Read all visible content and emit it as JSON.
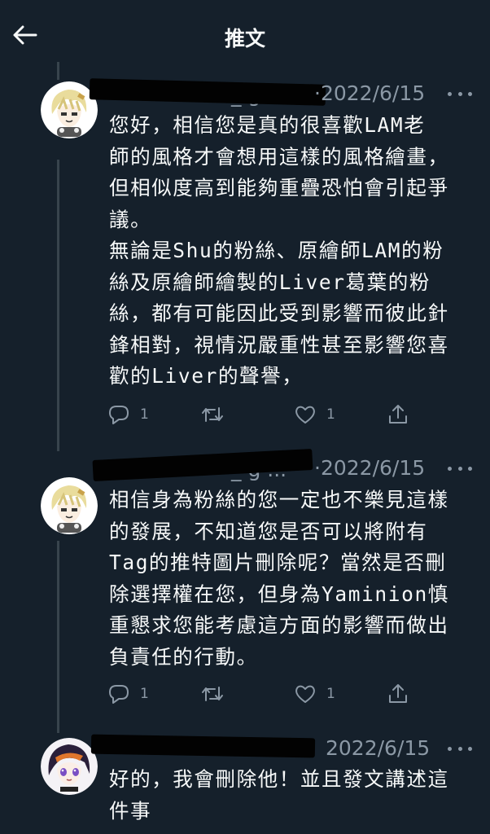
{
  "header": {
    "title": "推文"
  },
  "tweets": [
    {
      "name_visible": "_ g",
      "date": "·2022/6/15",
      "text": "您好，相信您是真的很喜歡LAM老\n師的風格才會想用這樣的風格繪畫，\n但相似度高到能夠重疊恐怕會引起爭\n議。\n無論是Shu的粉絲、原繪師LAM的粉\n絲及原繪師繪製的Liver葛葉的粉\n絲，都有可能因此受到影響而彼此針\n鋒相對，視情況嚴重性甚至影響您喜\n歡的Liver的聲譽，",
      "reply_count": "1",
      "like_count": "1"
    },
    {
      "name_visible": "_ g ...",
      "date": "·2022/6/15",
      "text": "相信身為粉絲的您一定也不樂見這樣\n的發展，不知道您是否可以將附有\nTag的推特圖片刪除呢？當然是否刪\n除選擇權在您，但身為Yaminion慎\n重懇求您能考慮這方面的影響而做出\n負責任的行動。",
      "reply_count": "1",
      "like_count": "1"
    },
    {
      "name_visible": "",
      "date": "2022/6/15",
      "text": "好的，我會刪除他！並且發文講述這\n件事"
    }
  ],
  "icons": {
    "back": "arrow-left-icon",
    "more": "more-dots-icon",
    "reply": "reply-bubble-icon",
    "retweet": "retweet-icon",
    "like": "heart-icon",
    "share": "share-icon"
  },
  "colors": {
    "background": "#15202b",
    "text": "#f7f9f9",
    "secondary": "#8b98a5",
    "thread_line": "#38444d"
  }
}
